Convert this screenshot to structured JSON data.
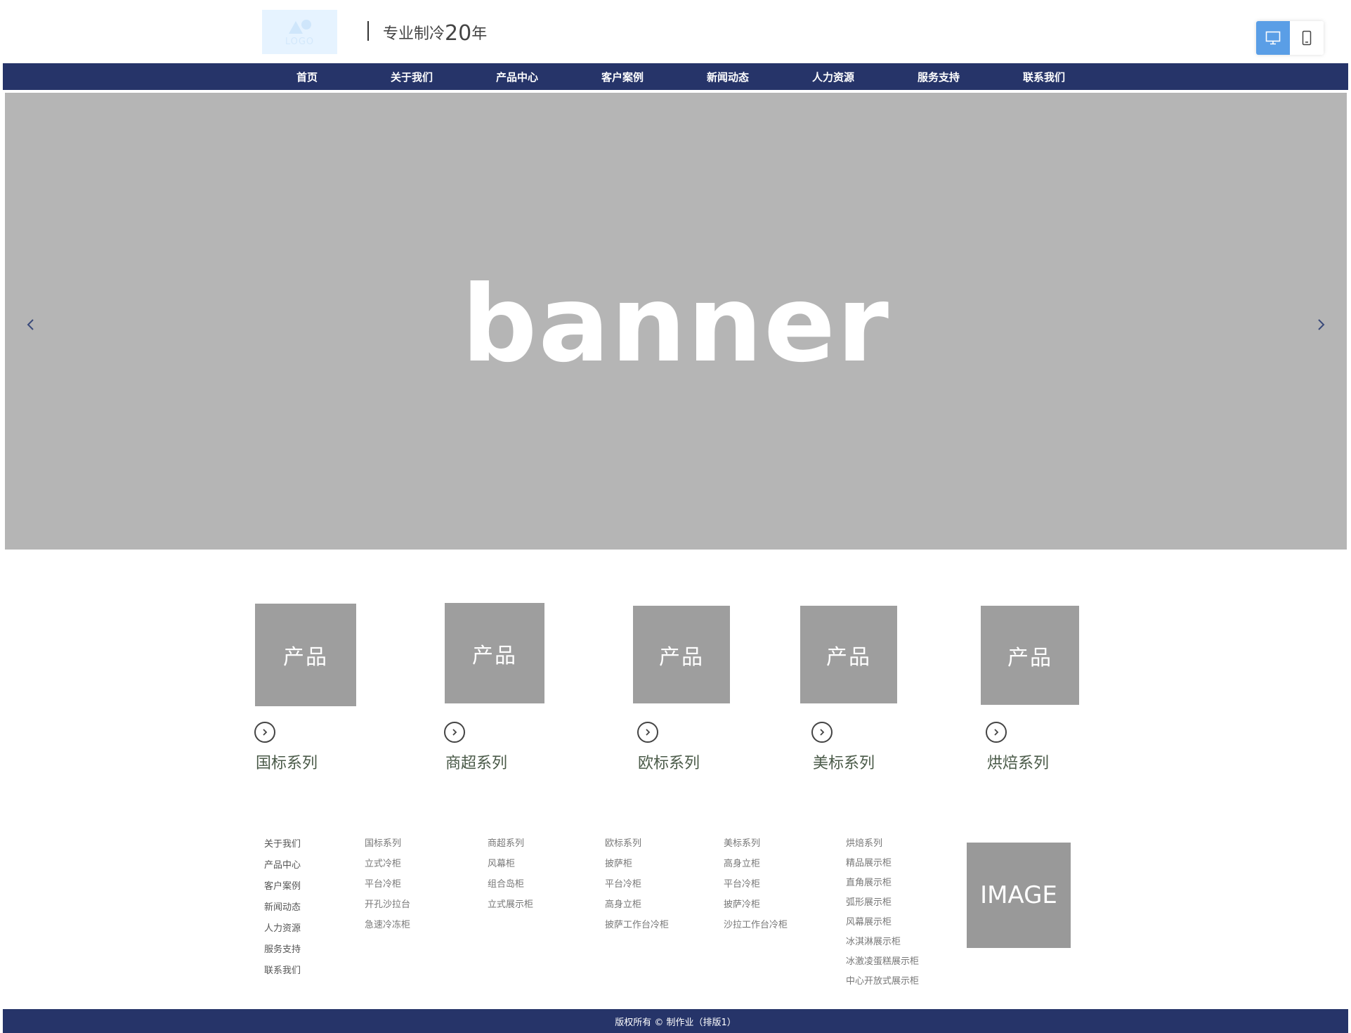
{
  "header": {
    "logo_text": "LOGO",
    "tagline_prefix": "专业制冷",
    "tagline_number": "20",
    "tagline_suffix": "年"
  },
  "device_toggle": {
    "desktop_icon": "desktop-icon",
    "mobile_icon": "mobile-icon",
    "active": "desktop"
  },
  "nav": {
    "items": [
      "首页",
      "关于我们",
      "产品中心",
      "客户案例",
      "新闻动态",
      "人力资源",
      "服务支持",
      "联系我们"
    ]
  },
  "banner": {
    "text": "banner",
    "prev_icon": "chevron-left-icon",
    "next_icon": "chevron-right-icon"
  },
  "products": [
    {
      "image_label": "产品",
      "name": "国标系列"
    },
    {
      "image_label": "产品",
      "name": "商超系列"
    },
    {
      "image_label": "产品",
      "name": "欧标系列"
    },
    {
      "image_label": "产品",
      "name": "美标系列"
    },
    {
      "image_label": "产品",
      "name": "烘焙系列"
    }
  ],
  "footer": {
    "columns": [
      [
        "关于我们",
        "产品中心",
        "客户案例",
        "新闻动态",
        "人力资源",
        "服务支持",
        "联系我们"
      ],
      [
        "国标系列",
        "立式冷柜",
        "平台冷柜",
        "开孔沙拉台",
        "急速冷冻柜"
      ],
      [
        "商超系列",
        "风幕柜",
        "组合岛柜",
        "立式展示柜"
      ],
      [
        "欧标系列",
        "披萨柜",
        "平台冷柜",
        "高身立柜",
        "披萨工作台冷柜"
      ],
      [
        "美标系列",
        "高身立柜",
        "平台冷柜",
        "披萨冷柜",
        "沙拉工作台冷柜"
      ],
      [
        "烘焙系列",
        "精品展示柜",
        "直角展示柜",
        "弧形展示柜",
        "风幕展示柜",
        "冰淇淋展示柜",
        "冰激凌蛋糕展示柜",
        "中心开放式展示柜"
      ]
    ],
    "image_label": "IMAGE",
    "copyright": "版权所有 © 制作业（排版1）"
  },
  "colors": {
    "nav_bg": "#263469",
    "banner_bg": "#b5b5b5",
    "product_bg": "#9e9e9e",
    "accent": "#5a9ee6"
  }
}
